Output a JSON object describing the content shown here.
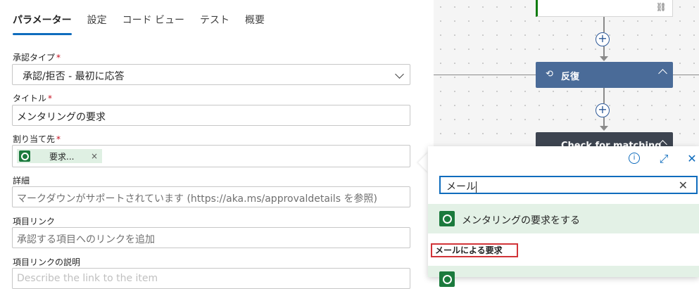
{
  "tabs": [
    {
      "label": "パラメーター",
      "active": true
    },
    {
      "label": "設定"
    },
    {
      "label": "コード ビュー"
    },
    {
      "label": "テスト"
    },
    {
      "label": "概要"
    }
  ],
  "fields": {
    "approval_type": {
      "label": "承認タイプ",
      "required": "*",
      "value": "承認/拒否 - 最初に応答"
    },
    "title": {
      "label": "タイトル",
      "required": "*",
      "value": "メンタリングの要求"
    },
    "assigned_to": {
      "label": "割り当て先",
      "required": "*",
      "chip_label": "要求...",
      "chip_remove": "×"
    },
    "details": {
      "label": "詳細",
      "placeholder": "マークダウンがサポートされています (https://aka.ms/approvaldetails を参照)"
    },
    "item_link": {
      "label": "項目リンク",
      "placeholder": "承認する項目へのリンクを追加"
    },
    "item_link_desc": {
      "label": "項目リンクの説明",
      "placeholder": "Describe the link to the item"
    }
  },
  "canvas": {
    "loop_card_label": "反復",
    "loop_icon": "⟲",
    "check_card_label": "Check for matching",
    "link_icon": "⛓",
    "plus_label": "+"
  },
  "popup": {
    "search_value": "メール",
    "clear_icon": "✕",
    "info_icon": "i",
    "expand_icon": "⤢",
    "close_icon": "✕",
    "result_1": "メンタリングの要求をする",
    "section_header": "メールによる要求"
  },
  "colors": {
    "accent": "#0f6cbd",
    "loop_card": "#4a6b98",
    "result_bg": "#e3f1e6",
    "highlight_border": "#d13438"
  }
}
